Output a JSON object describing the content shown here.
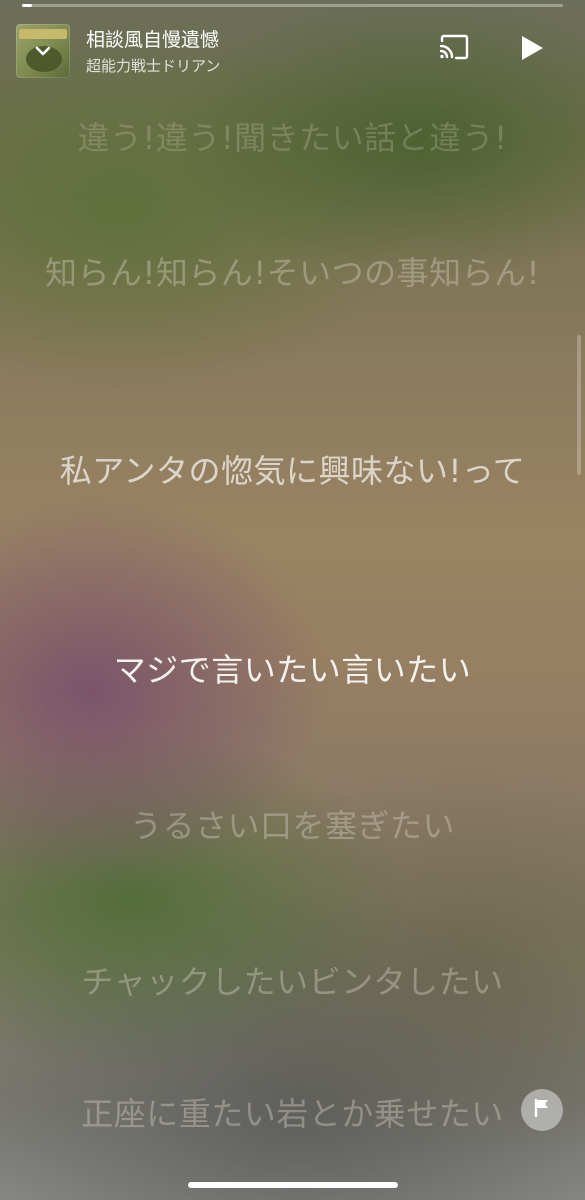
{
  "player": {
    "progress_fraction": 0.018,
    "song_title": "相談風自慢遺憾",
    "artist": "超能力戦士ドリアン",
    "icons": {
      "collapse": "chevron-down-icon",
      "cast": "cast-icon",
      "play": "play-icon",
      "report": "flag-icon"
    }
  },
  "lyrics": [
    {
      "text": "違う!違う!聞きたい話と違う!",
      "state": "faded-top"
    },
    {
      "text": "知らん!知らん!そいつの事知らん!",
      "state": "dim"
    },
    {
      "text": "私アンタの惚気に興味ない!って",
      "state": "near"
    },
    {
      "text": "マジで言いたい言いたい",
      "state": "active"
    },
    {
      "text": "うるさい口を塞ぎたい",
      "state": "dim"
    },
    {
      "text": "チャックしたいビンタしたい",
      "state": "dim"
    },
    {
      "text": "正座に重たい岩とか乗せたい",
      "state": "dim"
    }
  ]
}
